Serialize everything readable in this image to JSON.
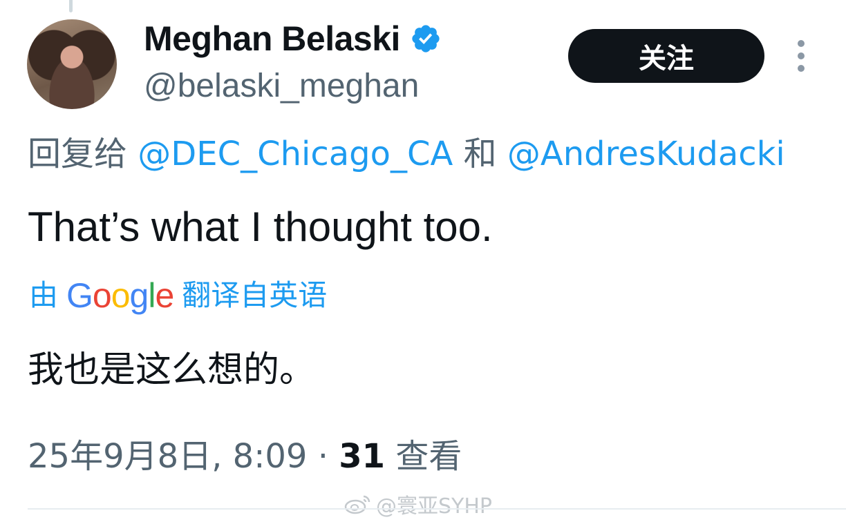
{
  "author": {
    "display_name": "Meghan Belaski",
    "handle": "@belaski_meghan",
    "verified_icon": "verified-badge"
  },
  "follow_button": {
    "label": "关注"
  },
  "more_menu": {
    "icon": "more-vertical-icon"
  },
  "reply_context": {
    "prefix": "回复给",
    "mentions": [
      "@DEC_Chicago_CA",
      "@AndresKudacki"
    ],
    "joiner": "和"
  },
  "tweet": {
    "text": "That’s what I thought too.",
    "translation_prefix": "由",
    "translation_provider": "Google",
    "translation_suffix": "翻译自英语",
    "translated_text": "我也是这么想的。"
  },
  "meta": {
    "date": "25年9月8日, 8:09",
    "dot": "·",
    "views_count": "31",
    "views_label": "查看"
  },
  "watermark": {
    "text": "@寰亚SYHP"
  },
  "colors": {
    "accent": "#1d9bf0",
    "text": "#0f1419",
    "secondary": "#536471",
    "button": "#0f1419"
  }
}
